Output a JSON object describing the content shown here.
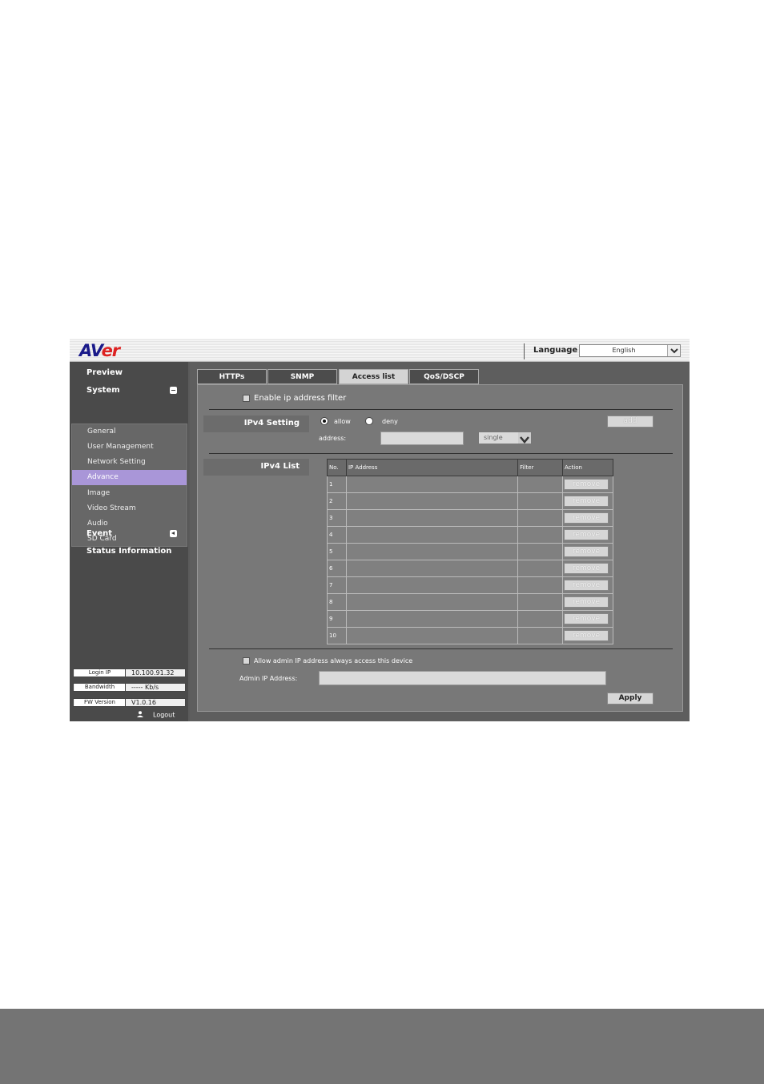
{
  "header": {
    "logo_prefix": "AV",
    "logo_suffix": "er",
    "language_label": "Language",
    "language_value": "English"
  },
  "sidebar": {
    "preview": "Preview",
    "system": "System",
    "system_items": [
      "General",
      "User Management",
      "Network Setting",
      "Advance",
      "Image",
      "Video Stream",
      "Audio",
      "SD Card"
    ],
    "active_item": "Advance",
    "event": "Event",
    "status": "Status Information",
    "info": {
      "login_ip_label": "Login IP",
      "login_ip": "10.100.91.32",
      "bandwidth_label": "Bandwidth",
      "bandwidth": "----- Kb/s",
      "fw_label": "FW Version",
      "fw": "V1.0.16"
    },
    "logout": "Logout"
  },
  "tabs": [
    "HTTPs",
    "SNMP",
    "Access list",
    "QoS/DSCP"
  ],
  "active_tab": "Access list",
  "filter": {
    "enable_label": "Enable ip address filter",
    "ipv4_setting_label": "IPv4 Setting",
    "allow_label": "allow",
    "deny_label": "deny",
    "selected": "allow",
    "address_label": "address:",
    "address_value": "",
    "mode_value": "single",
    "add_label": "add"
  },
  "ipv4_list": {
    "label": "IPv4 List",
    "columns": [
      "No.",
      "IP Address",
      "Filter",
      "Action"
    ],
    "rows": [
      {
        "no": "1",
        "ip": "",
        "filter": "",
        "action": "remove"
      },
      {
        "no": "2",
        "ip": "",
        "filter": "",
        "action": "remove"
      },
      {
        "no": "3",
        "ip": "",
        "filter": "",
        "action": "remove"
      },
      {
        "no": "4",
        "ip": "",
        "filter": "",
        "action": "remove"
      },
      {
        "no": "5",
        "ip": "",
        "filter": "",
        "action": "remove"
      },
      {
        "no": "6",
        "ip": "",
        "filter": "",
        "action": "remove"
      },
      {
        "no": "7",
        "ip": "",
        "filter": "",
        "action": "remove"
      },
      {
        "no": "8",
        "ip": "",
        "filter": "",
        "action": "remove"
      },
      {
        "no": "9",
        "ip": "",
        "filter": "",
        "action": "remove"
      },
      {
        "no": "10",
        "ip": "",
        "filter": "",
        "action": "remove"
      }
    ]
  },
  "admin": {
    "allow_label": "Allow admin IP address always access this device",
    "ip_label": "Admin IP Address:",
    "ip_value": ""
  },
  "apply_label": "Apply"
}
